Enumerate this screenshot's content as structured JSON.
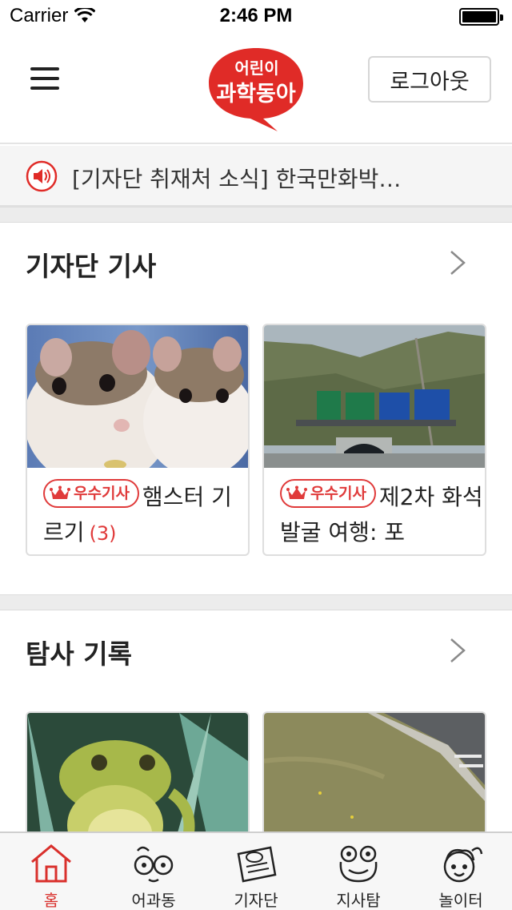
{
  "status_bar": {
    "carrier": "Carrier",
    "time": "2:46 PM",
    "battery_level": 1.0
  },
  "header": {
    "logo_text_top": "어린이",
    "logo_text_bottom": "과학동아",
    "logout_label": "로그아웃",
    "brand_color": "#e02b27"
  },
  "notice": {
    "text": "[기자단 취재처 소식] 한국만화박…",
    "icon": "speaker-icon"
  },
  "sections": [
    {
      "title": "기자단 기사",
      "cards": [
        {
          "badge": "우수기사",
          "title": "햄스터 기르기",
          "count": "(3)",
          "image": "hamsters-photo"
        },
        {
          "badge": "우수기사",
          "title": "제2차 화석 발굴 여행: 포",
          "count": "",
          "image": "tunnel-road-photo"
        }
      ]
    },
    {
      "title": "탐사 기록",
      "cards": [
        {
          "image": "frog-photo"
        },
        {
          "image": "grass-roadside-photo"
        }
      ]
    }
  ],
  "tabbar": {
    "tabs": [
      {
        "label": "홈",
        "icon": "home-icon",
        "active": true
      },
      {
        "label": "어과동",
        "icon": "glasses-face-icon",
        "active": false
      },
      {
        "label": "기자단",
        "icon": "press-card-icon",
        "active": false
      },
      {
        "label": "지사탐",
        "icon": "frog-face-icon",
        "active": false
      },
      {
        "label": "놀이터",
        "icon": "kid-face-icon",
        "active": false
      }
    ],
    "active_color": "#d9302c"
  }
}
